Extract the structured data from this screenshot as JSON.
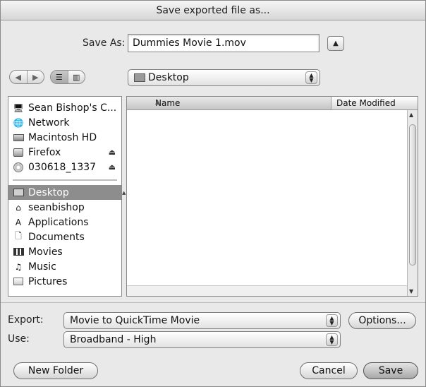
{
  "window": {
    "title": "Save exported file as..."
  },
  "save_as": {
    "label": "Save As:",
    "value": "Dummies Movie 1.mov",
    "toggle_icon": "triangle-up-icon"
  },
  "nav": {
    "back_icon": "back-arrow-icon",
    "forward_icon": "forward-arrow-icon",
    "list_view_icon": "list-view-icon",
    "column_view_icon": "column-view-icon",
    "location": "Desktop"
  },
  "sidebar": {
    "devices": [
      {
        "label": "Sean  Bishop's C...",
        "icon": "computer-icon"
      },
      {
        "label": "Network",
        "icon": "network-icon"
      },
      {
        "label": "Macintosh HD",
        "icon": "hard-drive-icon"
      },
      {
        "label": "Firefox",
        "icon": "disk-image-icon",
        "eject": true
      },
      {
        "label": "030618_1337",
        "icon": "cd-icon",
        "eject": true
      }
    ],
    "places": [
      {
        "label": "Desktop",
        "icon": "desktop-icon",
        "selected": true
      },
      {
        "label": "seanbishop",
        "icon": "home-icon"
      },
      {
        "label": "Applications",
        "icon": "applications-icon"
      },
      {
        "label": "Documents",
        "icon": "documents-icon"
      },
      {
        "label": "Movies",
        "icon": "movies-icon"
      },
      {
        "label": "Music",
        "icon": "music-icon"
      },
      {
        "label": "Pictures",
        "icon": "pictures-icon"
      }
    ]
  },
  "file_list": {
    "columns": [
      "Name",
      "Date Modified"
    ]
  },
  "export": {
    "label": "Export:",
    "value": "Movie to QuickTime Movie",
    "options_label": "Options..."
  },
  "use": {
    "label": "Use:",
    "value": "Broadband - High"
  },
  "buttons": {
    "new_folder": "New Folder",
    "cancel": "Cancel",
    "save": "Save"
  }
}
